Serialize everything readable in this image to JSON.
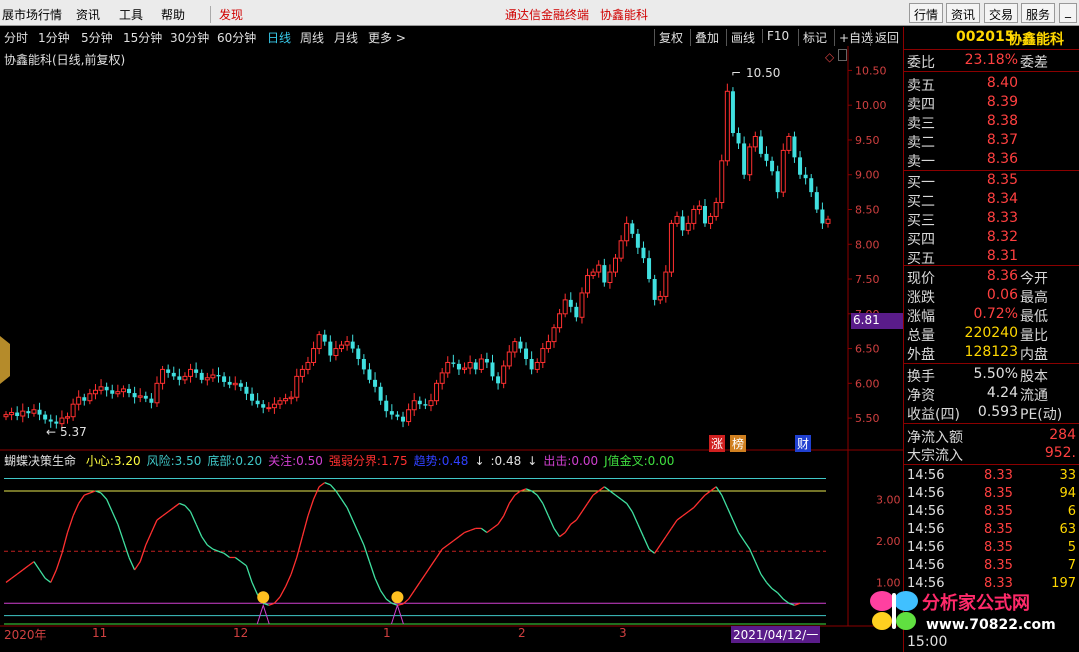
{
  "menubar": {
    "left": [
      "展市场行情",
      "资讯",
      "工具",
      "帮助"
    ],
    "active": "发现",
    "center": "通达信金融终端",
    "stock_name": "协鑫能科",
    "right": [
      "行情",
      "资讯",
      "交易",
      "服务"
    ],
    "window_icons": [
      "minimize",
      "maximize"
    ]
  },
  "timeframes": [
    "分时",
    "1分钟",
    "5分钟",
    "15分钟",
    "30分钟",
    "60分钟",
    "日线",
    "周线",
    "月线",
    "更多 >"
  ],
  "selected_timeframe": "日线",
  "toolbar_buttons": [
    "复权",
    "叠加",
    "画线",
    "F10",
    "标记",
    "+自选",
    "返回"
  ],
  "main_chart": {
    "title": "协鑫能科(日线,前复权)",
    "y_ticks": [
      "10.50",
      "10.00",
      "9.50",
      "9.00",
      "8.50",
      "8.00",
      "7.50",
      "7.00",
      "6.50",
      "6.00",
      "5.50"
    ],
    "high_label": "10.50",
    "low_label": "5.37",
    "current_price_tag": "6.81",
    "badges": [
      "涨",
      "榜",
      "财"
    ]
  },
  "indicator": {
    "name": "蝴蝶决策生命",
    "params": [
      {
        "label": "小心:",
        "value": "3.20",
        "color": "#ffff40"
      },
      {
        "label": "风险:",
        "value": "3.50",
        "color": "#40c8c8"
      },
      {
        "label": "底部:",
        "value": "0.20",
        "color": "#40c8c8"
      },
      {
        "label": "关注:",
        "value": "0.50",
        "color": "#d040d0"
      },
      {
        "label": "强弱分界:",
        "value": "1.75",
        "color": "#ff3030"
      },
      {
        "label": "趋势:",
        "value": "0.48",
        "color": "#3040ff"
      },
      {
        "label": "",
        "value": "↓",
        "color": "#e0e0e0"
      },
      {
        "label": ":",
        "value": "0.48",
        "color": "#e0e0e0"
      },
      {
        "label": "",
        "value": "↓",
        "color": "#e0e0e0"
      },
      {
        "label": "出击:",
        "value": "0.00",
        "color": "#d040d0"
      },
      {
        "label": "J值金叉:",
        "value": "0.00",
        "color": "#40e040"
      }
    ],
    "y_ticks": [
      "3.00",
      "2.00",
      "1.00"
    ]
  },
  "x_axis": [
    "2020年",
    "11",
    "12",
    "1",
    "2",
    "3",
    "2021/04/12/一"
  ],
  "sidebar": {
    "code": "002015",
    "name": "协鑫能科",
    "ratio_label": "委比",
    "ratio_value": "23.18%",
    "ratio_diff_label": "委差",
    "sells": [
      {
        "label": "卖五",
        "price": "8.40"
      },
      {
        "label": "卖四",
        "price": "8.39"
      },
      {
        "label": "卖三",
        "price": "8.38"
      },
      {
        "label": "卖二",
        "price": "8.37"
      },
      {
        "label": "卖一",
        "price": "8.36"
      }
    ],
    "buys": [
      {
        "label": "买一",
        "price": "8.35"
      },
      {
        "label": "买二",
        "price": "8.34"
      },
      {
        "label": "买三",
        "price": "8.33"
      },
      {
        "label": "买四",
        "price": "8.32"
      },
      {
        "label": "买五",
        "price": "8.31"
      }
    ],
    "quote": [
      {
        "l": "现价",
        "v": "8.36",
        "r": "今开"
      },
      {
        "l": "涨跌",
        "v": "0.06",
        "r": "最高"
      },
      {
        "l": "涨幅",
        "v": "0.72%",
        "r": "最低"
      },
      {
        "l": "总量",
        "v": "220240",
        "r": "量比"
      },
      {
        "l": "外盘",
        "v": "128123",
        "r": "内盘"
      }
    ],
    "quote2": [
      {
        "l": "换手",
        "v": "5.50%",
        "r": "股本"
      },
      {
        "l": "净资",
        "v": "4.24",
        "r": "流通"
      },
      {
        "l": "收益(四)",
        "v": "0.593",
        "r": "PE(动)"
      }
    ],
    "flow": [
      {
        "l": "净流入额",
        "v": "284"
      },
      {
        "l": "大宗流入",
        "v": "952."
      }
    ],
    "ticks": [
      {
        "t": "14:56",
        "p": "8.33",
        "v": "33"
      },
      {
        "t": "14:56",
        "p": "8.35",
        "v": "94"
      },
      {
        "t": "14:56",
        "p": "8.35",
        "v": "6"
      },
      {
        "t": "14:56",
        "p": "8.35",
        "v": "63"
      },
      {
        "t": "14:56",
        "p": "8.35",
        "v": "5"
      },
      {
        "t": "14:56",
        "p": "8.35",
        "v": "7"
      },
      {
        "t": "14:56",
        "p": "8.33",
        "v": "197"
      }
    ],
    "bottom_time": "15:00"
  },
  "watermark": {
    "title": "分析家公式网",
    "url": "www.70822.com"
  },
  "chart_data": {
    "type": "candlestick",
    "y_range": [
      5.3,
      10.65
    ],
    "closes": [
      5.55,
      5.58,
      5.53,
      5.6,
      5.57,
      5.62,
      5.55,
      5.48,
      5.45,
      5.42,
      5.5,
      5.52,
      5.7,
      5.8,
      5.75,
      5.85,
      5.9,
      5.95,
      5.9,
      5.85,
      5.88,
      5.92,
      5.86,
      5.8,
      5.82,
      5.78,
      5.72,
      6.0,
      6.2,
      6.15,
      6.1,
      6.05,
      6.1,
      6.2,
      6.15,
      6.05,
      6.08,
      6.12,
      6.1,
      6.02,
      5.98,
      6.0,
      5.95,
      5.85,
      5.75,
      5.7,
      5.65,
      5.65,
      5.7,
      5.75,
      5.78,
      5.8,
      6.1,
      6.2,
      6.3,
      6.5,
      6.7,
      6.6,
      6.4,
      6.5,
      6.55,
      6.6,
      6.5,
      6.35,
      6.2,
      6.05,
      5.95,
      5.75,
      5.6,
      5.55,
      5.52,
      5.45,
      5.62,
      5.75,
      5.7,
      5.68,
      5.75,
      6.0,
      6.15,
      6.3,
      6.28,
      6.2,
      6.22,
      6.3,
      6.2,
      6.35,
      6.3,
      6.1,
      6.0,
      6.25,
      6.45,
      6.6,
      6.5,
      6.35,
      6.2,
      6.3,
      6.5,
      6.6,
      6.8,
      7.0,
      7.2,
      7.1,
      6.95,
      7.3,
      7.55,
      7.6,
      7.7,
      7.45,
      7.6,
      7.8,
      8.05,
      8.3,
      8.15,
      7.95,
      7.8,
      7.5,
      7.2,
      7.25,
      7.6,
      8.3,
      8.4,
      8.2,
      8.3,
      8.5,
      8.55,
      8.3,
      8.4,
      8.6,
      9.2,
      10.2,
      9.6,
      9.45,
      9.0,
      9.4,
      9.55,
      9.3,
      9.2,
      9.05,
      8.75,
      9.35,
      9.55,
      9.25,
      9.0,
      8.95,
      8.75,
      8.5,
      8.3,
      8.36
    ],
    "indicator_levels": {
      "小心": 3.2,
      "风险": 3.5,
      "底部": 0.2,
      "关注": 0.5,
      "强弱分界": 1.75
    },
    "indicator_series": [
      1.0,
      1.1,
      1.2,
      1.3,
      1.4,
      1.5,
      1.3,
      1.1,
      1.0,
      1.3,
      1.7,
      2.2,
      2.6,
      2.9,
      3.1,
      3.15,
      3.2,
      3.15,
      3.0,
      2.7,
      2.4,
      2.0,
      1.6,
      1.3,
      1.5,
      1.9,
      2.2,
      2.5,
      2.6,
      2.7,
      2.8,
      2.9,
      2.85,
      2.7,
      2.4,
      2.1,
      1.9,
      1.8,
      1.75,
      1.7,
      1.6,
      1.6,
      1.5,
      1.4,
      1.0,
      0.7,
      0.5,
      0.45,
      0.5,
      0.65,
      0.9,
      1.2,
      1.6,
      2.1,
      2.6,
      3.0,
      3.3,
      3.4,
      3.35,
      3.2,
      3.0,
      2.8,
      2.5,
      2.2,
      1.9,
      1.5,
      1.1,
      0.8,
      0.6,
      0.5,
      0.45,
      0.48,
      0.6,
      0.8,
      1.0,
      1.2,
      1.4,
      1.6,
      1.8,
      1.9,
      2.0,
      2.1,
      2.2,
      2.25,
      2.3,
      2.3,
      2.2,
      2.3,
      2.4,
      2.6,
      2.9,
      3.1,
      3.2,
      3.25,
      3.2,
      3.1,
      2.9,
      2.6,
      2.3,
      2.1,
      2.2,
      2.4,
      2.5,
      2.7,
      2.9,
      3.1,
      3.2,
      3.3,
      3.2,
      3.1,
      3.0,
      2.9,
      2.7,
      2.4,
      2.1,
      1.8,
      1.7,
      1.9,
      2.1,
      2.3,
      2.5,
      2.6,
      2.7,
      2.8,
      2.95,
      3.1,
      3.2,
      3.3,
      3.1,
      2.8,
      2.5,
      2.2,
      2.0,
      1.8,
      1.5,
      1.2,
      1.0,
      0.85,
      0.75,
      0.6,
      0.5,
      0.45,
      0.5
    ]
  }
}
